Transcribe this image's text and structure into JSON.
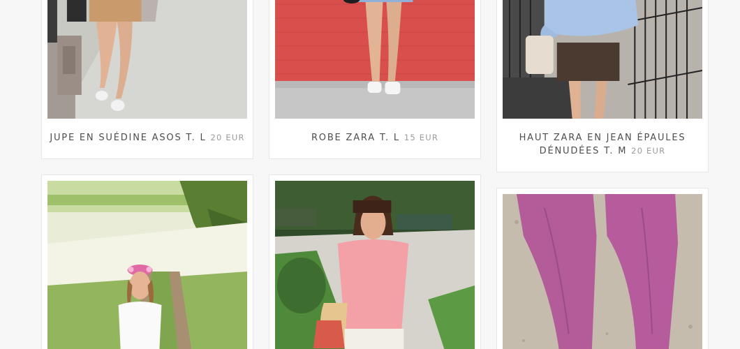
{
  "products": [
    {
      "name": "Jupe en suédine Asos T. L",
      "price": "20 EUR"
    },
    {
      "name": "Robe Zara T. L",
      "price": "15 EUR"
    },
    {
      "name": "Haut Zara en jean épaules dénudées T. M",
      "price": "20 EUR"
    }
  ],
  "colors": {
    "page_background": "#f7f7f7",
    "card_background": "#ffffff",
    "card_border": "#e6e6e6",
    "caption_text": "#4d4d4d",
    "price_text": "#9b9b9b"
  }
}
